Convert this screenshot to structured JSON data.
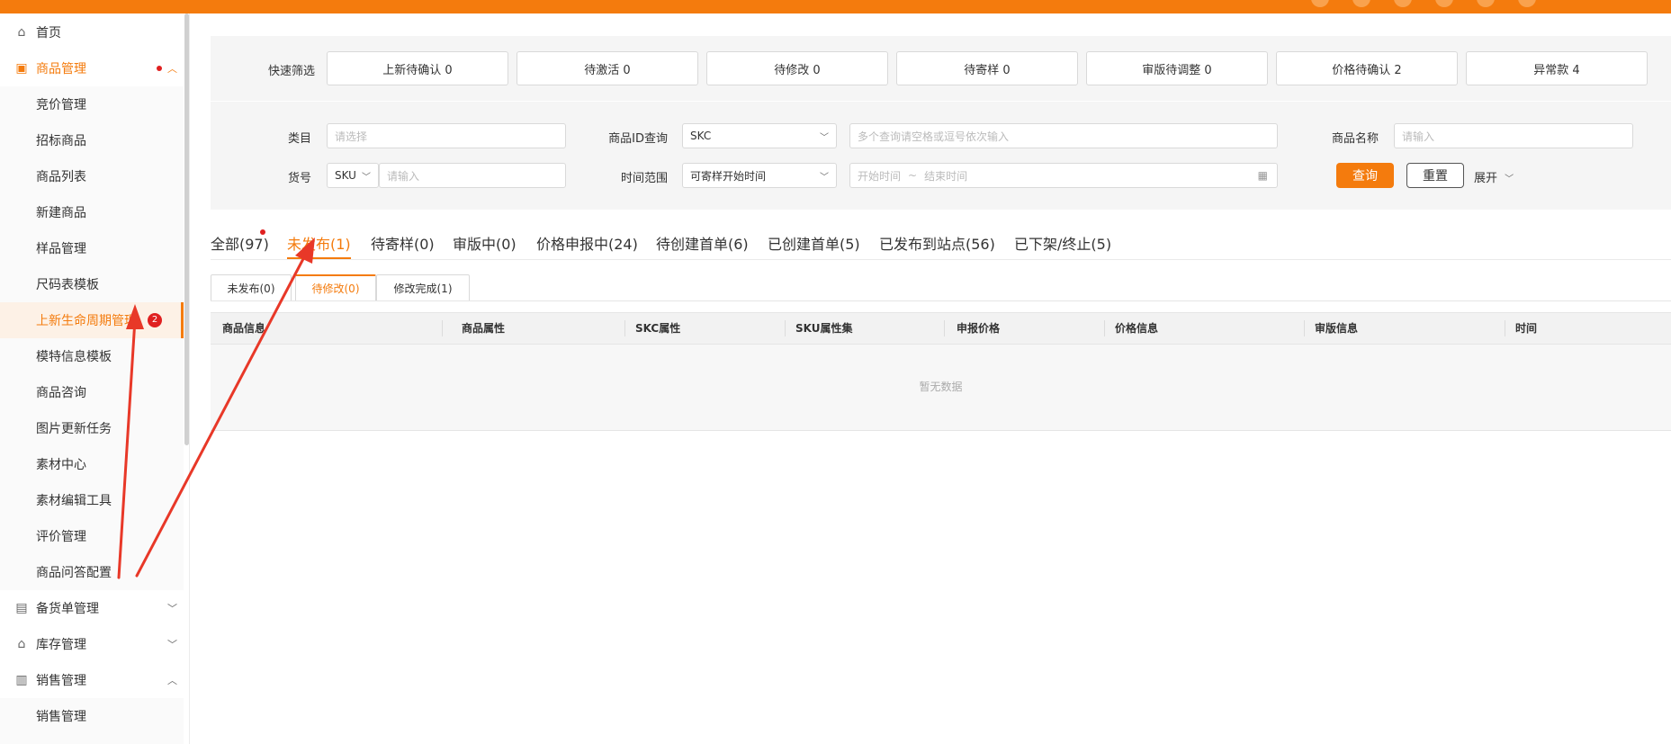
{
  "sidebar": {
    "home": "首页",
    "product_mgmt": "商品管理",
    "sub_items": [
      "竞价管理",
      "招标商品",
      "商品列表",
      "新建商品",
      "样品管理",
      "尺码表模板",
      "上新生命周期管理",
      "模特信息模板",
      "商品咨询",
      "图片更新任务",
      "素材中心",
      "素材编辑工具",
      "评价管理",
      "商品问答配置"
    ],
    "active_badge": "2",
    "stock_mgmt": "备货单管理",
    "inventory_mgmt": "库存管理",
    "sales_mgmt": "销售管理",
    "sales_sub": "销售管理"
  },
  "quick_filter": {
    "label": "快速筛选",
    "buttons": [
      "上新待确认 0",
      "待激活 0",
      "待修改 0",
      "待寄样 0",
      "审版待调整 0",
      "价格待确认 2",
      "异常款 4"
    ]
  },
  "filters": {
    "category_label": "类目",
    "category_placeholder": "请选择",
    "id_query_label": "商品ID查询",
    "id_type": "SKC",
    "id_placeholder": "多个查询请空格或逗号依次输入",
    "name_label": "商品名称",
    "name_placeholder": "请输入",
    "sku_label": "货号",
    "sku_type": "SKU",
    "sku_placeholder": "请输入",
    "time_label": "时间范围",
    "time_type": "可寄样开始时间",
    "time_start": "开始时间",
    "time_sep": "~",
    "time_end": "结束时间",
    "query_btn": "查询",
    "reset_btn": "重置",
    "expand_btn": "展开"
  },
  "tabs": [
    "全部(97)",
    "未发布(1)",
    "待寄样(0)",
    "审版中(0)",
    "价格申报中(24)",
    "待创建首单(6)",
    "已创建首单(5)",
    "已发布到站点(56)",
    "已下架/终止(5)"
  ],
  "subtabs": [
    "未发布(0)",
    "待修改(0)",
    "修改完成(1)"
  ],
  "table": {
    "headers": [
      "商品信息",
      "商品属性",
      "SKC属性",
      "SKU属性集",
      "申报价格",
      "价格信息",
      "审版信息",
      "时间"
    ],
    "empty_text": "暂无数据"
  },
  "colors": {
    "accent": "#f47b0d",
    "annotation": "#e83828"
  }
}
